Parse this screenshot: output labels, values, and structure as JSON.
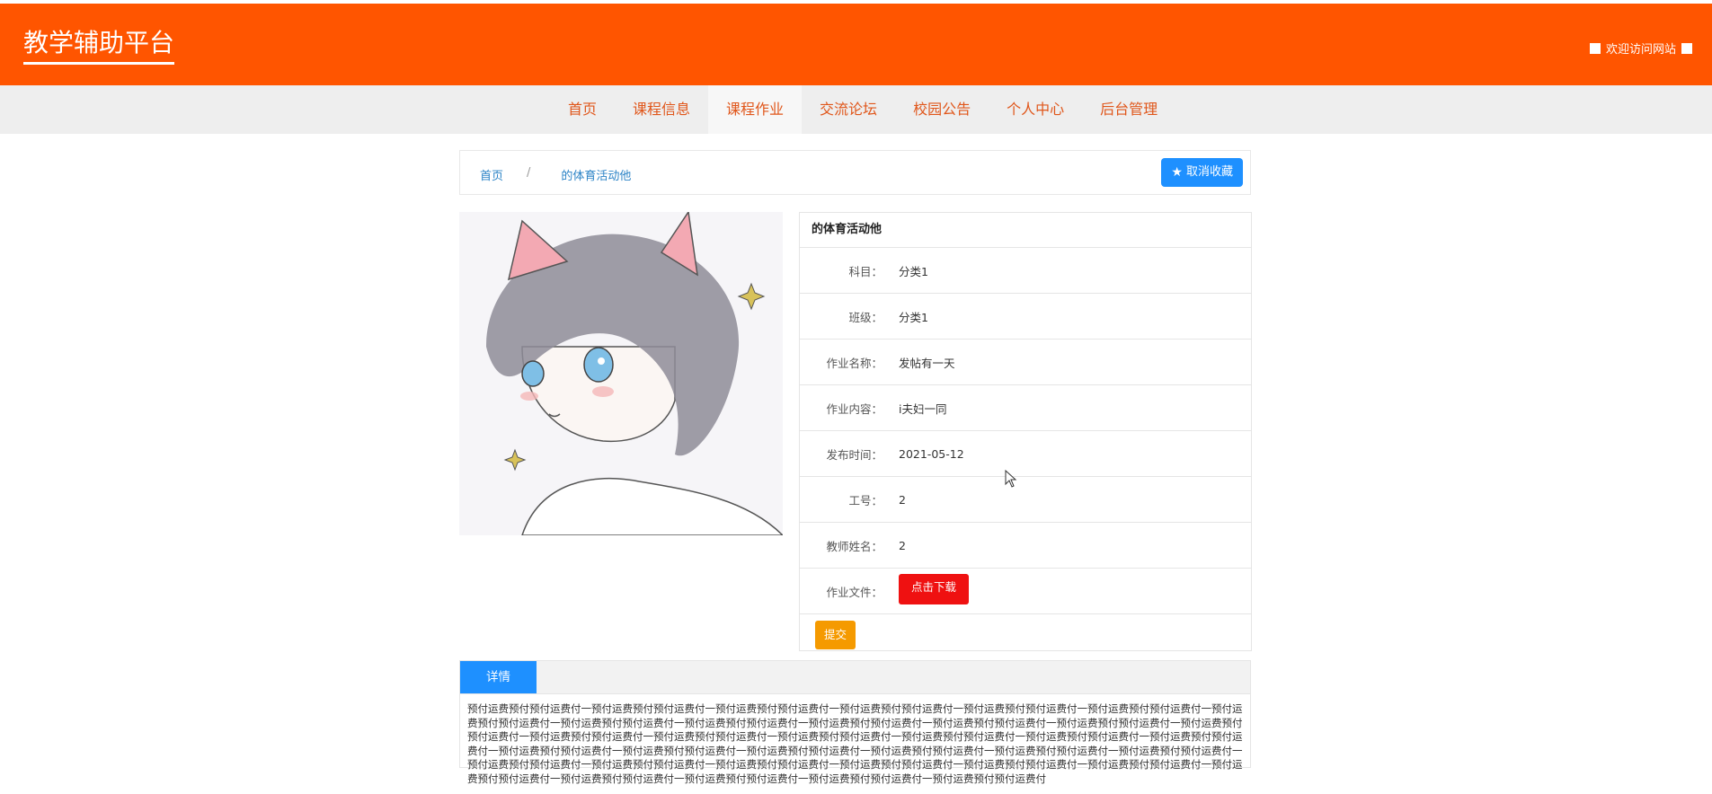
{
  "header": {
    "logo": "教学辅助平台",
    "welcome": "欢迎访问网站"
  },
  "nav": [
    {
      "label": "首页"
    },
    {
      "label": "课程信息"
    },
    {
      "label": "课程作业",
      "active": true
    },
    {
      "label": "交流论坛"
    },
    {
      "label": "校园公告"
    },
    {
      "label": "个人中心"
    },
    {
      "label": "后台管理"
    }
  ],
  "breadcrumb": {
    "home": "首页",
    "sep": "/",
    "current": "的体育活动他"
  },
  "favorite_button": "取消收藏",
  "info": {
    "title": "的体育活动他",
    "rows": [
      {
        "label": "科目：",
        "value": "分类1"
      },
      {
        "label": "班级：",
        "value": "分类1"
      },
      {
        "label": "作业名称：",
        "value": "发帖有一天"
      },
      {
        "label": "作业内容：",
        "value": "i夫妇一同"
      },
      {
        "label": "发布时间：",
        "value": "2021-05-12"
      },
      {
        "label": "工号：",
        "value": "2"
      },
      {
        "label": "教师姓名：",
        "value": "2"
      }
    ],
    "file_label": "作业文件：",
    "download_button": "点击下载",
    "submit_button": "提交"
  },
  "detail": {
    "tab": "详情",
    "text": "预付运费预付预付运费付一预付运费预付预付运费付一预付运费预付预付运费付一预付运费预付预付运费付一预付运费预付预付运费付一预付运费预付预付运费付一预付运费预付预付运费付一预付运费预付预付运费付一预付运费预付预付运费付一预付运费预付预付运费付一预付运费预付预付运费付一预付运费预付预付运费付一预付运费预付预付运费付一预付运费预付预付运费付一预付运费预付预付运费付一预付运费预付预付运费付一预付运费预付预付运费付一预付运费预付预付运费付一预付运费预付预付运费付一预付运费预付预付运费付一预付运费预付预付运费付一预付运费预付预付运费付一预付运费预付预付运费付一预付运费预付预付运费付一预付运费预付预付运费付一预付运费预付预付运费付一预付运费预付预付运费付一预付运费预付预付运费付一预付运费预付预付运费付一预付运费预付预付运费付一预付运费预付预付运费付一预付运费预付预付运费付一预付运费预付预付运费付一预付运费预付预付运费付一预付运费预付预付运费付一预付运费预付预付运费付"
  },
  "colors": {
    "header": "#ff5500",
    "nav_text": "#e0561a",
    "favorite": "#1e90ff",
    "download": "#ef1111",
    "submit": "#f59a00",
    "tab": "#1e90ff"
  }
}
